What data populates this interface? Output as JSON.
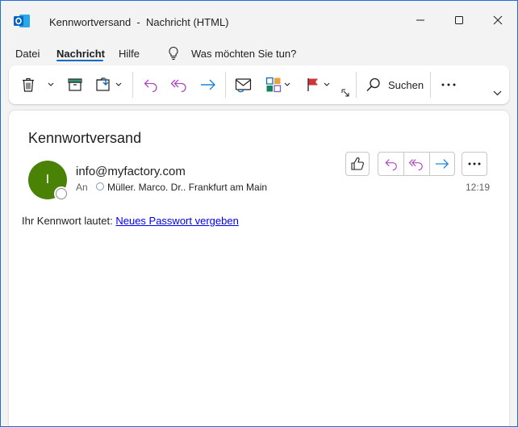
{
  "window": {
    "title": "Kennwortversand  -  Nachricht (HTML)",
    "controls": {
      "minimize": "minimize-icon",
      "maximize": "maximize-icon",
      "close": "close-icon"
    },
    "app_icon": "outlook-icon",
    "accent_color": "#1e6fd9"
  },
  "menu": {
    "items": [
      "Datei",
      "Nachricht",
      "Hilfe"
    ],
    "active": "Nachricht",
    "tell_me": "Was möchten Sie tun?"
  },
  "ribbon": {
    "buttons": [
      {
        "icon": "delete-icon",
        "has_dropdown": true
      },
      {
        "icon": "archive-icon"
      },
      {
        "icon": "move-icon",
        "has_dropdown": true
      },
      {
        "icon": "reply-icon",
        "color": "#b146c2"
      },
      {
        "icon": "reply-all-icon",
        "color": "#b146c2"
      },
      {
        "icon": "forward-icon",
        "color": "#1a86d9"
      },
      {
        "icon": "read-unread-icon"
      },
      {
        "icon": "categorize-icon",
        "has_dropdown": true
      },
      {
        "icon": "flag-icon",
        "color": "#d13438",
        "has_dropdown": true
      },
      {
        "icon": "dialog-launcher-icon"
      }
    ],
    "search_label": "Suchen",
    "more": "more-icon",
    "expand": "chevron-down-icon"
  },
  "message": {
    "subject": "Kennwortversand",
    "sender_initial": "I",
    "sender": "info@myfactory.com",
    "to_label": "An",
    "to_value": "Müller. Marco. Dr.. Frankfurt am Main",
    "time": "12:19",
    "avatar_color": "#498205",
    "body_prefix": "Ihr Kennwort lautet: ",
    "body_link": "Neues Passwort vergeben"
  }
}
